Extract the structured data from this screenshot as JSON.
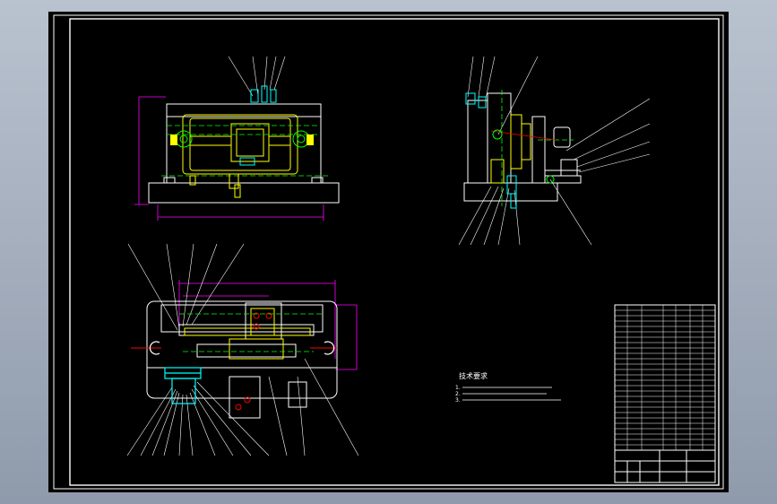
{
  "drawing": {
    "background_color": "#000000",
    "frame_color": "#ffffff",
    "dimension_color": "#ff00ff",
    "outline_color": "#ffffff",
    "part_color": "#ffff00",
    "center_line_color": "#00ff00",
    "detail_color": "#ff0000",
    "hidden_color": "#00ffff",
    "tech_notes": {
      "title": "技术要求",
      "lines": [
        "1.",
        "2.",
        "3."
      ]
    }
  }
}
